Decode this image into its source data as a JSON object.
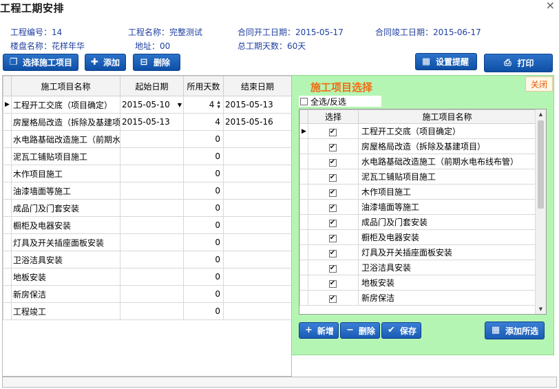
{
  "window": {
    "title": "工程工期安排",
    "close_glyph": "×"
  },
  "info": {
    "project_no": "工程编号：14",
    "project_name": "工程名称：完整测试",
    "contract_start": "合同开工日期：2015-05-17",
    "contract_end": "合同竣工日期：2015-06-17",
    "building": "楼盘名称：花样年华",
    "address": "地址：00",
    "total_days": "总工期天数：60天"
  },
  "toolbar": {
    "select_items": "选择施工项目",
    "add": "添加",
    "delete": "删除",
    "reminder": "设置提醒",
    "print": "打印"
  },
  "schedule": {
    "headers": [
      "施工项目名称",
      "起始日期",
      "所用天数",
      "结束日期"
    ],
    "rows": [
      {
        "name": "工程开工交底（项目确定）",
        "start": "2015-05-10",
        "days": "4",
        "end": "2015-05-13"
      },
      {
        "name": "房屋格局改造（拆除及基建项目）",
        "start": "2015-05-13",
        "days": "4",
        "end": "2015-05-16"
      },
      {
        "name": "水电路基础改造施工（前期水电布线布管）",
        "start": "",
        "days": "0",
        "end": ""
      },
      {
        "name": "泥瓦工铺贴项目施工",
        "start": "",
        "days": "0",
        "end": ""
      },
      {
        "name": "木作项目施工",
        "start": "",
        "days": "0",
        "end": ""
      },
      {
        "name": "油漆墙面等施工",
        "start": "",
        "days": "0",
        "end": ""
      },
      {
        "name": "成品门及门套安装",
        "start": "",
        "days": "0",
        "end": ""
      },
      {
        "name": "橱柜及电器安装",
        "start": "",
        "days": "0",
        "end": ""
      },
      {
        "name": "灯具及开关插座面板安装",
        "start": "",
        "days": "0",
        "end": ""
      },
      {
        "name": "卫浴洁具安装",
        "start": "",
        "days": "0",
        "end": ""
      },
      {
        "name": "地板安装",
        "start": "",
        "days": "0",
        "end": ""
      },
      {
        "name": "新房保洁",
        "start": "",
        "days": "0",
        "end": ""
      },
      {
        "name": "工程竣工",
        "start": "",
        "days": "0",
        "end": ""
      }
    ]
  },
  "panel": {
    "title": "施工项目选择",
    "close": "关闭",
    "select_all": "全选/反选",
    "headers": [
      "选择",
      "施工项目名称"
    ],
    "items": [
      {
        "name": "工程开工交底（项目确定）",
        "checked": true
      },
      {
        "name": "房屋格局改造（拆除及基建项目）",
        "checked": true
      },
      {
        "name": "水电路基础改造施工（前期水电布线布管）",
        "checked": true
      },
      {
        "name": "泥瓦工铺贴项目施工",
        "checked": true
      },
      {
        "name": "木作项目施工",
        "checked": true
      },
      {
        "name": "油漆墙面等施工",
        "checked": true
      },
      {
        "name": "成品门及门套安装",
        "checked": true
      },
      {
        "name": "橱柜及电器安装",
        "checked": true
      },
      {
        "name": "灯具及开关插座面板安装",
        "checked": true
      },
      {
        "name": "卫浴洁具安装",
        "checked": true
      },
      {
        "name": "地板安装",
        "checked": true
      },
      {
        "name": "新房保洁",
        "checked": true
      }
    ],
    "buttons": {
      "new": "新增",
      "delete": "删除",
      "save": "保存",
      "add_selected": "添加所选"
    }
  },
  "colors": {
    "button_blue": "#1a5cb5",
    "panel_green": "#b5f5b3",
    "title_orange": "#f36b12",
    "info_blue": "#1f3f9f"
  }
}
